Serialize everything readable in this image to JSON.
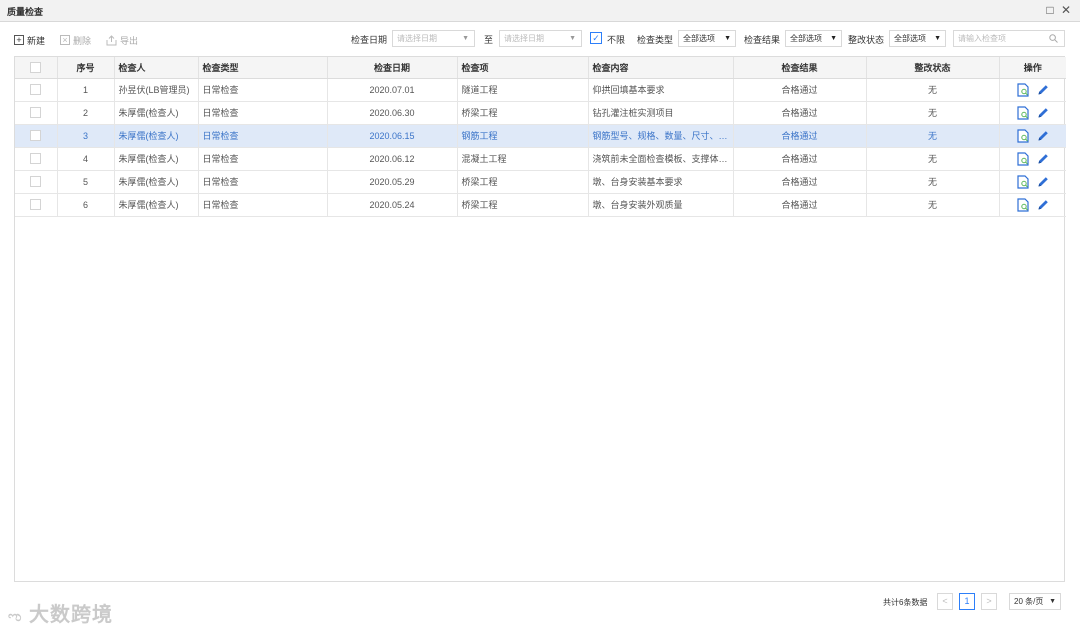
{
  "window": {
    "title": "质量检查",
    "maximize_glyph": "□",
    "close_glyph": "✕"
  },
  "toolbar": {
    "new_label": "新建",
    "delete_label": "删除",
    "export_label": "导出"
  },
  "filters": {
    "date_label": "检查日期",
    "date_start_placeholder": "请选择日期",
    "date_to_label": "至",
    "date_end_placeholder": "请选择日期",
    "unlimited_label": "不限",
    "unlimited_checked": true,
    "type_label": "检查类型",
    "type_value": "全部选项",
    "result_label": "检查结果",
    "result_value": "全部选项",
    "rectify_label": "整改状态",
    "rectify_value": "全部选项",
    "search_placeholder": "请输入检查项"
  },
  "table": {
    "columns": [
      "序号",
      "检查人",
      "检查类型",
      "检查日期",
      "检查项",
      "检查内容",
      "检查结果",
      "整改状态",
      "操作"
    ],
    "rows": [
      {
        "no": "1",
        "inspector": "孙昱伏(LB管理员)",
        "type": "日常检查",
        "date": "2020.07.01",
        "item": "隧道工程",
        "content": "仰拱回填基本要求",
        "result": "合格通过",
        "status": "无",
        "selected": false
      },
      {
        "no": "2",
        "inspector": "朱厚儒(检查人)",
        "type": "日常检查",
        "date": "2020.06.30",
        "item": "桥梁工程",
        "content": "钻孔灌注桩实测项目",
        "result": "合格通过",
        "status": "无",
        "selected": false
      },
      {
        "no": "3",
        "inspector": "朱厚儒(检查人)",
        "type": "日常检查",
        "date": "2020.06.15",
        "item": "钢筋工程",
        "content": "钢筋型号、规格、数量、尺寸、间...",
        "result": "合格通过",
        "status": "无",
        "selected": true
      },
      {
        "no": "4",
        "inspector": "朱厚儒(检查人)",
        "type": "日常检查",
        "date": "2020.06.12",
        "item": "混凝土工程",
        "content": "浇筑前未全面检查模板、支撑体系...",
        "result": "合格通过",
        "status": "无",
        "selected": false
      },
      {
        "no": "5",
        "inspector": "朱厚儒(检查人)",
        "type": "日常检查",
        "date": "2020.05.29",
        "item": "桥梁工程",
        "content": "墩、台身安装基本要求",
        "result": "合格通过",
        "status": "无",
        "selected": false
      },
      {
        "no": "6",
        "inspector": "朱厚儒(检查人)",
        "type": "日常检查",
        "date": "2020.05.24",
        "item": "桥梁工程",
        "content": "墩、台身安装外观质量",
        "result": "合格通过",
        "status": "无",
        "selected": false
      }
    ]
  },
  "pagination": {
    "total_text": "共计6条数据",
    "prev_glyph": "<",
    "current_page": "1",
    "next_glyph": ">",
    "page_size": "20 条/页"
  },
  "watermark": "大数跨境",
  "colors": {
    "accent": "#2d7ff9",
    "selected_row_bg": "#dfe9f8",
    "icon_blue": "#2f6fd6"
  }
}
